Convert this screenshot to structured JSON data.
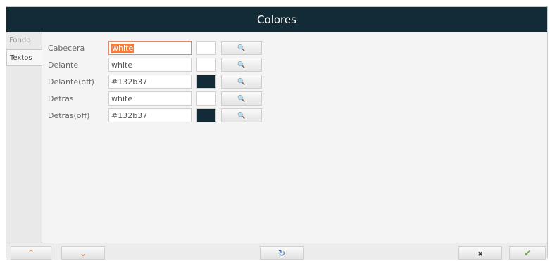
{
  "window": {
    "title": "Colores"
  },
  "tabs": [
    {
      "label": "Fondo"
    },
    {
      "label": "Textos"
    }
  ],
  "rows": [
    {
      "label": "Cabecera",
      "value": "white",
      "swatch": "#ffffff"
    },
    {
      "label": "Delante",
      "value": "white",
      "swatch": "#ffffff"
    },
    {
      "label": "Delante(off)",
      "value": "#132b37",
      "swatch": "#132b37"
    },
    {
      "label": "Detras",
      "value": "white",
      "swatch": "#ffffff"
    },
    {
      "label": "Detras(off)",
      "value": "#132b37",
      "swatch": "#132b37"
    }
  ],
  "icons": {
    "pick": "🔍",
    "up": "⌃",
    "down": "⌄",
    "refresh": "↻",
    "cancel": "✖",
    "accept": "✔"
  },
  "colors": {
    "title_bg": "#132b37",
    "accent_focus": "#f07d3c"
  }
}
